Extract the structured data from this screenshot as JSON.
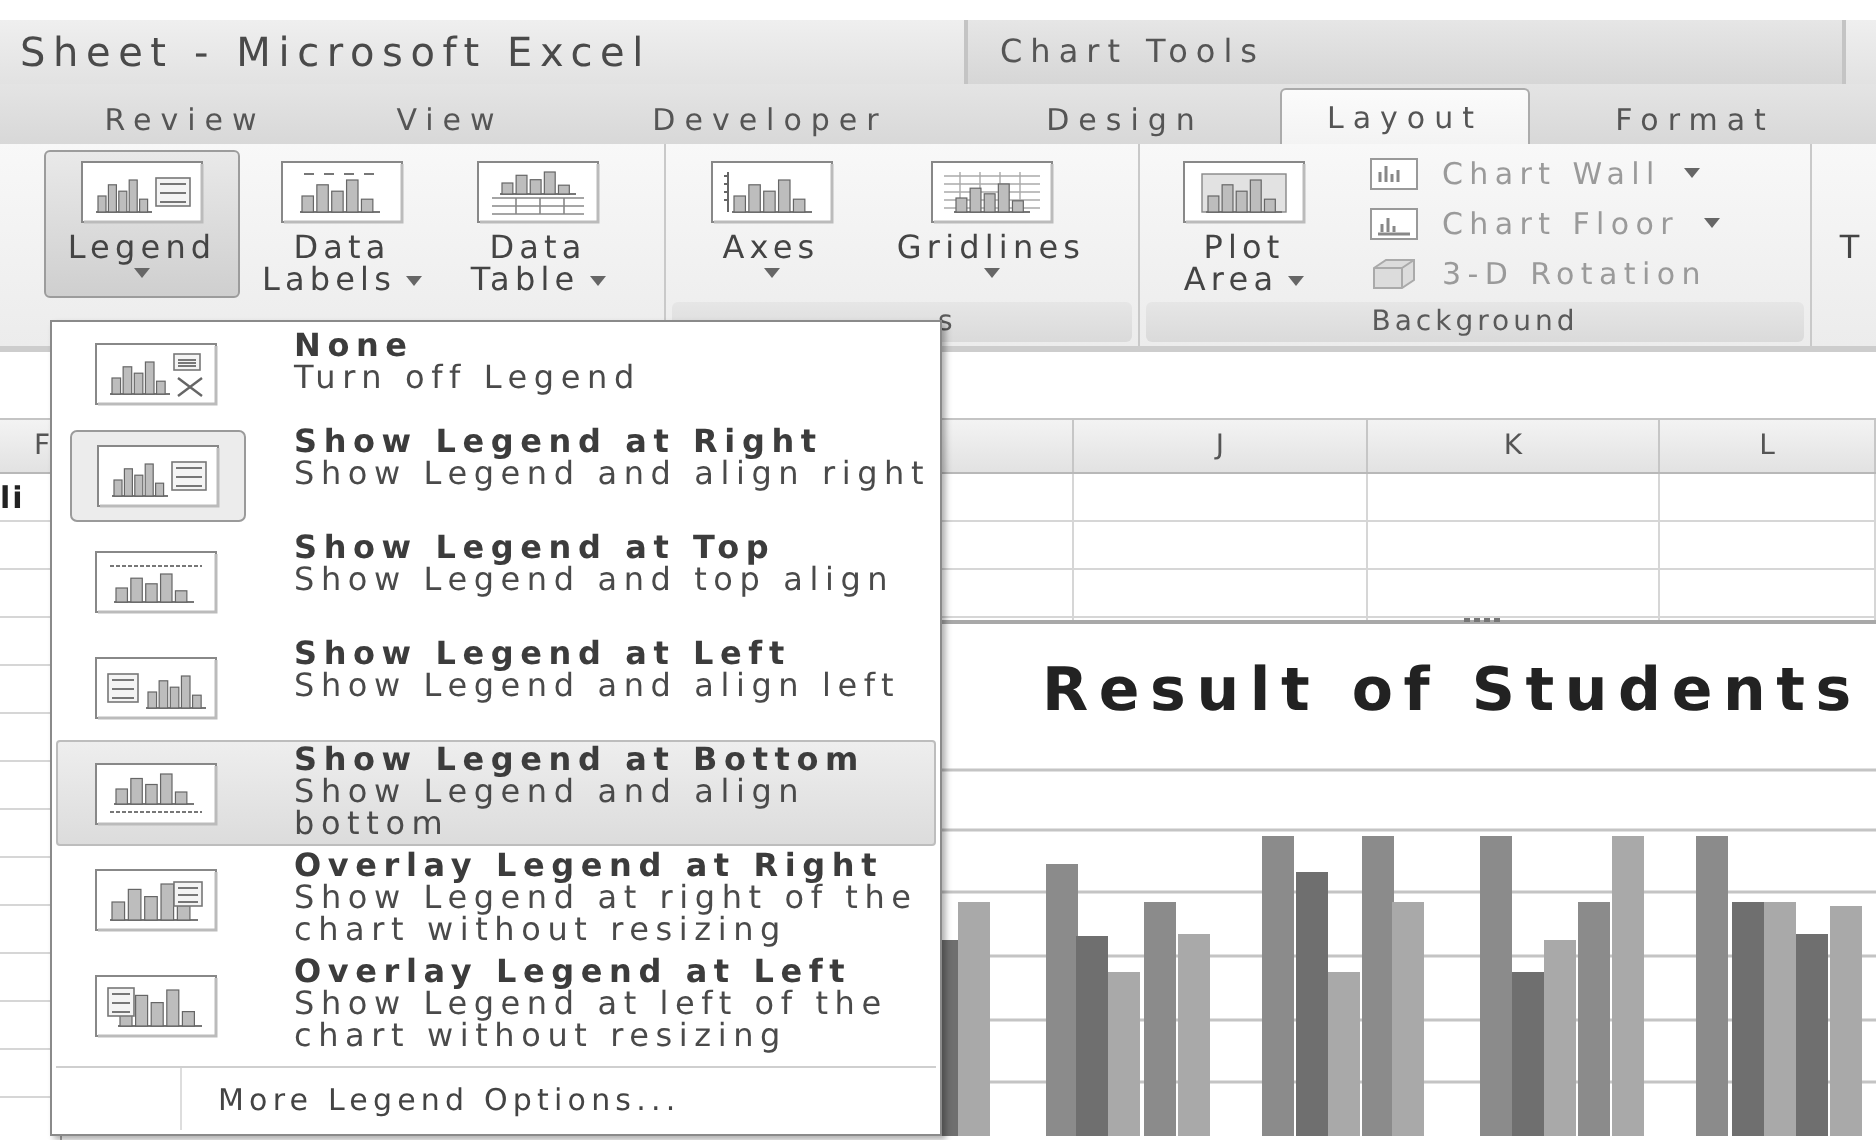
{
  "window": {
    "title": "Sheet - Microsoft Excel",
    "context_title": "Chart Tools"
  },
  "tabs": [
    {
      "label": "Review",
      "selected": false
    },
    {
      "label": "View",
      "selected": false
    },
    {
      "label": "Developer",
      "selected": false
    },
    {
      "label": "Design",
      "selected": false
    },
    {
      "label": "Layout",
      "selected": true
    },
    {
      "label": "Format",
      "selected": false
    }
  ],
  "ribbon": {
    "groups": [
      {
        "buttons": [
          {
            "label": "Legend",
            "caret_below": true,
            "pressed": true
          },
          {
            "label": "Data Labels",
            "caret_below": false,
            "pressed": false
          },
          {
            "label": "Data Table",
            "caret_below": false,
            "pressed": false
          }
        ]
      },
      {
        "label": "s",
        "buttons": [
          {
            "label": "Axes",
            "caret_below": true,
            "pressed": false
          },
          {
            "label": "Gridlines",
            "caret_below": true,
            "pressed": false
          }
        ]
      },
      {
        "label": "Background",
        "buttons": [
          {
            "label": "Plot Area",
            "caret_below": false,
            "pressed": false
          }
        ],
        "small_buttons": [
          {
            "label": "Chart Wall",
            "caret": true,
            "disabled": true
          },
          {
            "label": "Chart Floor",
            "caret": true,
            "disabled": true
          },
          {
            "label": "3-D Rotation",
            "caret": false,
            "disabled": true
          }
        ]
      },
      {
        "buttons": [
          {
            "label": "T",
            "pressed": false
          }
        ]
      }
    ]
  },
  "sheet": {
    "column_headers": [
      "F",
      "J",
      "K",
      "L"
    ],
    "cell_text": "li"
  },
  "chart": {
    "title": "Result of Students"
  },
  "legend_menu": {
    "items": [
      {
        "title": "None",
        "description": "Turn off Legend",
        "selected": false,
        "current": false
      },
      {
        "title": "Show Legend at Right",
        "description": "Show Legend and align right",
        "selected": false,
        "current": true
      },
      {
        "title": "Show Legend at Top",
        "description": "Show Legend and top align",
        "selected": false,
        "current": false
      },
      {
        "title": "Show Legend at Left",
        "description": "Show Legend and align left",
        "selected": false,
        "current": false
      },
      {
        "title": "Show Legend at Bottom",
        "description": "Show Legend and align bottom",
        "selected": true,
        "current": false
      },
      {
        "title": "Overlay Legend at Right",
        "description": "Show Legend at right of the chart without resizing",
        "selected": false,
        "current": false
      },
      {
        "title": "Overlay Legend at Left",
        "description": "Show Legend at left of the chart without resizing",
        "selected": false,
        "current": false
      }
    ],
    "footer": "More Legend Options..."
  }
}
